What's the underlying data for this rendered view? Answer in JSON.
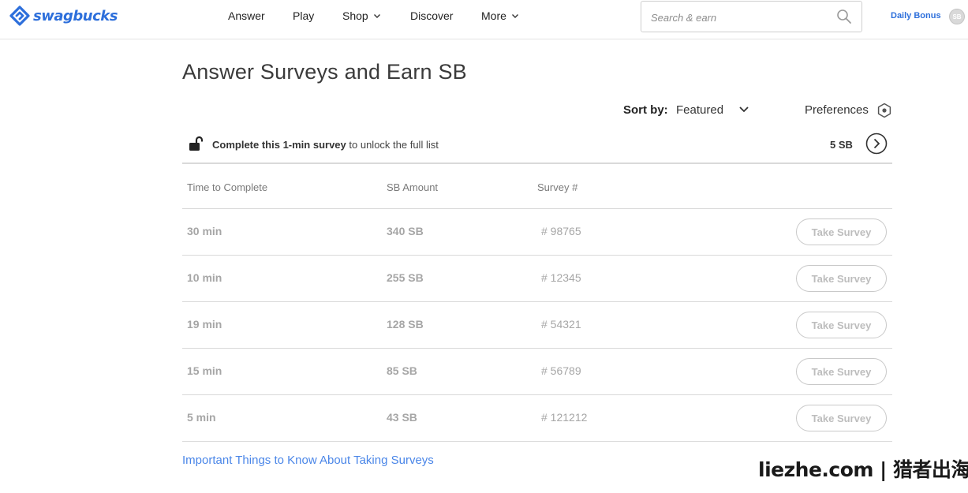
{
  "brand": {
    "name": "swagbucks",
    "color": "#2d6fdb"
  },
  "nav": {
    "items": [
      {
        "label": "Answer",
        "dropdown": false
      },
      {
        "label": "Play",
        "dropdown": false
      },
      {
        "label": "Shop",
        "dropdown": true
      },
      {
        "label": "Discover",
        "dropdown": false
      },
      {
        "label": "More",
        "dropdown": true
      }
    ]
  },
  "search": {
    "placeholder": "Search & earn",
    "icon": "search-icon"
  },
  "header": {
    "daily_bonus": "Daily Bonus",
    "badge": "SB"
  },
  "main": {
    "title": "Answer Surveys and Earn SB",
    "sort": {
      "label": "Sort by:",
      "value": "Featured"
    },
    "preferences": {
      "label": "Preferences",
      "icon": "gear-icon"
    },
    "unlock": {
      "bold": "Complete this 1-min survey",
      "rest": " to unlock the full list",
      "reward": "5 SB",
      "icon": "unlocked-lock-icon"
    },
    "table": {
      "headers": [
        "Time to Complete",
        "SB Amount",
        "Survey #"
      ],
      "rows": [
        {
          "time": "30 min",
          "amount": "340 SB",
          "survey": "# 98765",
          "action": "Take Survey"
        },
        {
          "time": "10 min",
          "amount": "255 SB",
          "survey": "# 12345",
          "action": "Take Survey"
        },
        {
          "time": "19 min",
          "amount": "128 SB",
          "survey": "# 54321",
          "action": "Take Survey"
        },
        {
          "time": "15 min",
          "amount": "85 SB",
          "survey": "# 56789",
          "action": "Take Survey"
        },
        {
          "time": "5 min",
          "amount": "43 SB",
          "survey": "# 121212",
          "action": "Take Survey"
        }
      ]
    },
    "info_link": "Important Things to Know About Taking Surveys"
  },
  "watermark": "liezhe.com | 猎者出海",
  "colors": {
    "accent": "#2d6fdb",
    "link": "#4a86e8",
    "muted_text": "#a6a6a6",
    "divider": "#d9d9d9"
  }
}
